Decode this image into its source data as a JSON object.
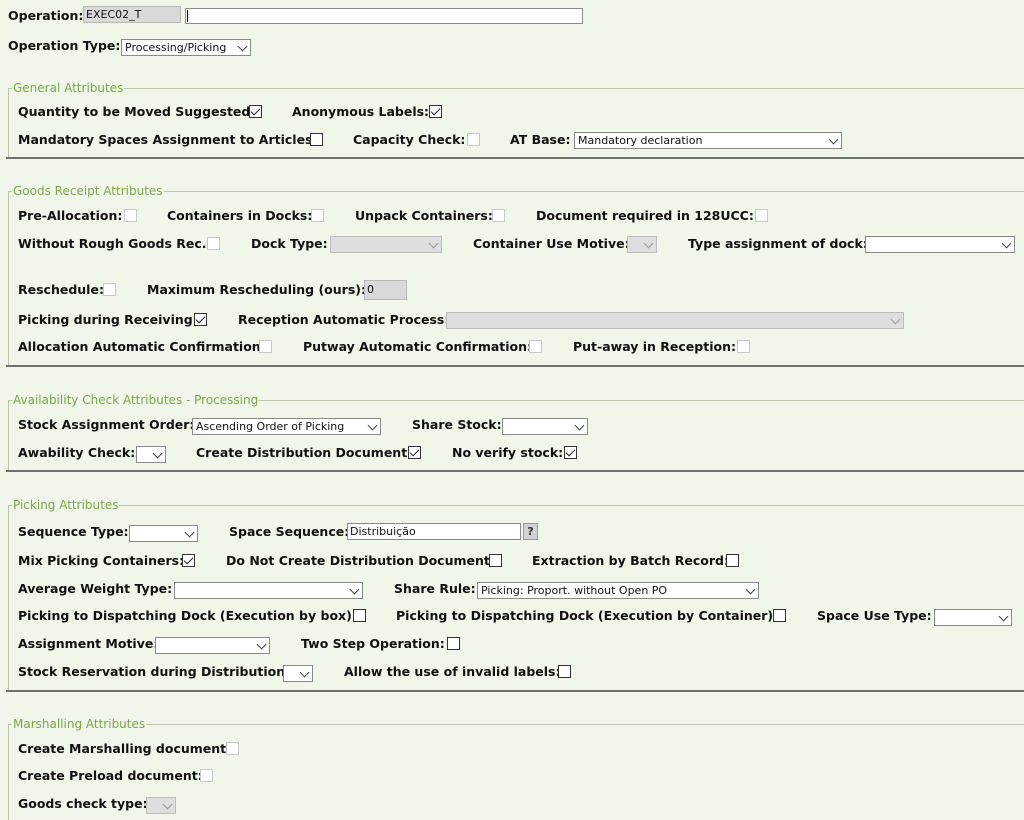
{
  "header": {
    "operation_label": "Operation:",
    "operation_code": "EXEC02_T",
    "operation_desc": "",
    "operation_type_label": "Operation Type:",
    "operation_type_value": "Processing/Picking"
  },
  "general": {
    "legend": "General Attributes",
    "qty_moved_label": "Quantity to be Moved Suggested:",
    "anon_labels_label": "Anonymous Labels:",
    "mandatory_spaces_label": "Mandatory Spaces Assignment to Articles:",
    "capacity_check_label": "Capacity Check:",
    "at_base_label": "AT Base:",
    "at_base_value": "Mandatory declaration"
  },
  "goods": {
    "legend": "Goods Receipt Attributes",
    "pre_allocation_label": "Pre-Allocation:",
    "containers_docks_label": "Containers in Docks:",
    "unpack_containers_label": "Unpack Containers:",
    "document_128ucc_label": "Document required in 128UCC:",
    "without_rough_label": "Without Rough Goods Rec.:",
    "dock_type_label": "Dock Type:",
    "container_use_label": "Container Use Motive:",
    "type_assign_dock_label": "Type assignment of dock:",
    "reschedule_label": "Reschedule:",
    "max_resched_label": "Maximum Rescheduling (ours):",
    "max_resched_value": "0",
    "picking_receiving_label": "Picking during Receiving:",
    "reception_auto_label": "Reception Automatic Process:",
    "alloc_auto_label": "Allocation Automatic Confirmation:",
    "putway_auto_label": "Putway Automatic Confirmation:",
    "putaway_reception_label": "Put-away in Reception:"
  },
  "availability": {
    "legend": "Availability Check Attributes - Processing",
    "stock_order_label": "Stock Assignment Order:",
    "stock_order_value": "Ascending Order of Picking",
    "share_stock_label": "Share Stock:",
    "awability_label": "Awability Check:",
    "create_dist_label": "Create Distribution Document:",
    "no_verify_label": "No verify stock:"
  },
  "picking": {
    "legend": "Picking Attributes",
    "sequence_type_label": "Sequence Type:",
    "space_sequence_label": "Space Sequence:",
    "space_sequence_value": "Distribuição",
    "help_button": "?",
    "mix_containers_label": "Mix Picking Containers:",
    "no_dist_doc_label": "Do Not Create Distribution Document:",
    "extraction_batch_label": "Extraction by Batch Record:",
    "avg_weight_label": "Average Weight Type:",
    "share_rule_label": "Share Rule:",
    "share_rule_value": "Picking: Proport. without Open PO",
    "pick_dock_box_label": "Picking to Dispatching Dock (Execution by box):",
    "pick_dock_container_label": "Picking to Dispatching Dock (Execution by Container):",
    "space_use_label": "Space Use Type:",
    "assignment_motive_label": "Assignment Motive:",
    "two_step_label": "Two Step Operation:",
    "stock_reservation_label": "Stock Reservation during Distribution:",
    "invalid_labels_label": "Allow the use of invalid labels:"
  },
  "marshalling": {
    "legend": "Marshalling Attributes",
    "create_marshalling_label": "Create Marshalling document:",
    "create_preload_label": "Create Preload document:",
    "goods_check_label": "Goods check type:"
  },
  "colors": {
    "background": "#f1f6ea",
    "legend": "#7da64a"
  }
}
